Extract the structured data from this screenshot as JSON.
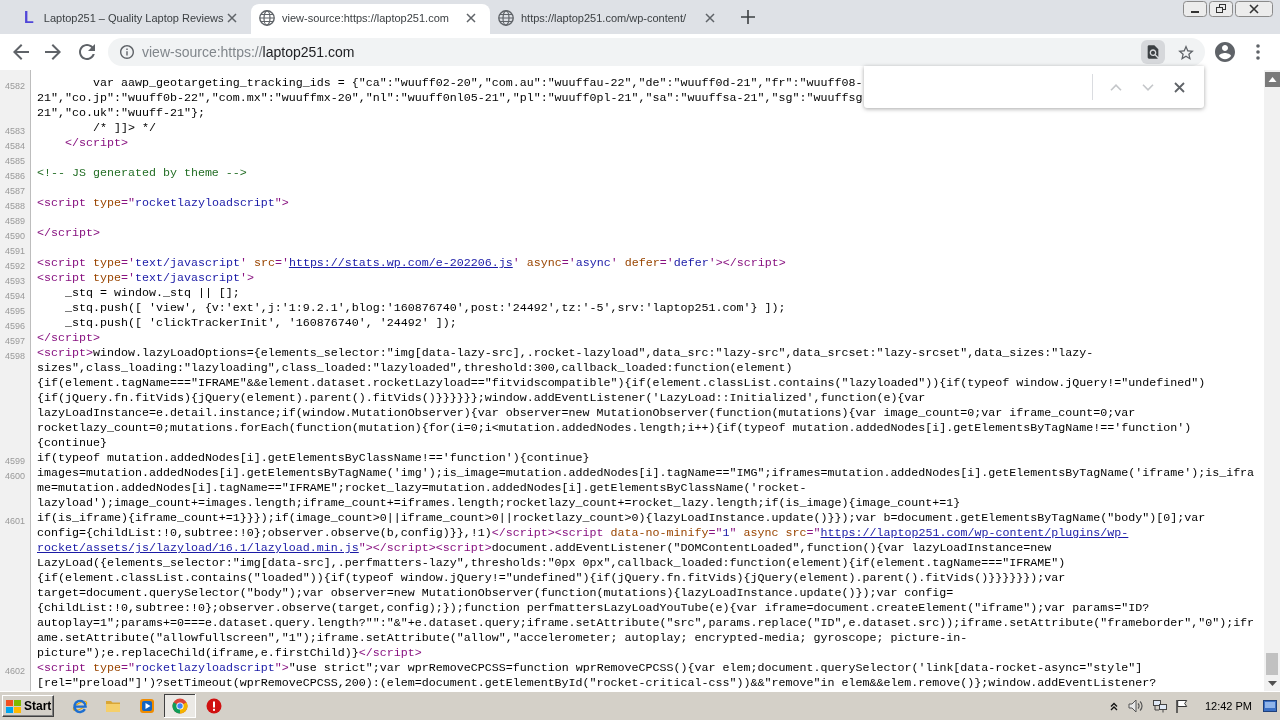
{
  "tabs": [
    {
      "title": "Laptop251 – Quality Laptop Reviews",
      "selected": false,
      "favicon": {
        "kind": "letter",
        "text": "L"
      }
    },
    {
      "title": "view-source:https://laptop251.com",
      "selected": true,
      "favicon": {
        "kind": "globe"
      }
    },
    {
      "title": "https://laptop251.com/wp-content/",
      "selected": false,
      "favicon": {
        "kind": "globe"
      }
    }
  ],
  "address_bar": {
    "url_prefix": "view-source:https://",
    "url_host": "laptop251.com",
    "find_active": true
  },
  "find_bar": {
    "previous_disabled": true,
    "next_disabled": true
  },
  "source_lines": [
    {
      "number": "4582",
      "rows": [
        {
          "tokens": [
            {
              "kind": "text",
              "text": "        var aawp_geotargeting_tracking_ids = {\"ca\":\"wuuff02-20\",\"com.au\":\"wuuffau-22\",\"de\":\"wuuff0d-21\",\"fr\":\"wuuff08-"
            }
          ]
        },
        {
          "tokens": [
            {
              "kind": "text",
              "text": "21\",\"co.jp\":\"wuuff0b-22\",\"com.mx\":\"wuuffmx-20\",\"nl\":\"wuuff0nl05-21\",\"pl\":\"wuuff0pl-21\",\"sa\":\"wuuffsa-21\",\"sg\":\"wuuffsg"
            }
          ]
        },
        {
          "tokens": [
            {
              "kind": "text",
              "text": "21\",\"co.uk\":\"wuuff-21\"};"
            }
          ]
        }
      ]
    },
    {
      "number": "4583",
      "rows": [
        {
          "tokens": [
            {
              "kind": "text",
              "text": "        /* ]]> */"
            }
          ]
        }
      ]
    },
    {
      "number": "4584",
      "rows": [
        {
          "tokens": [
            {
              "kind": "tag",
              "text": "    </script>"
            }
          ]
        }
      ]
    },
    {
      "number": "4585"
    },
    {
      "number": "4586",
      "rows": [
        {
          "tokens": [
            {
              "kind": "comment",
              "text": "<!-- JS generated by theme -->"
            }
          ]
        }
      ]
    },
    {
      "number": "4587"
    },
    {
      "number": "4588",
      "rows": [
        {
          "tokens": [
            {
              "kind": "tag",
              "text": "<script "
            },
            {
              "kind": "attr",
              "text": "type"
            },
            {
              "kind": "tag",
              "text": "=\""
            },
            {
              "kind": "value",
              "text": "rocketlazyloadscript"
            },
            {
              "kind": "tag",
              "text": "\">"
            }
          ]
        }
      ]
    },
    {
      "number": "4589"
    },
    {
      "number": "4590",
      "rows": [
        {
          "tokens": [
            {
              "kind": "tag",
              "text": "</script>"
            }
          ]
        }
      ]
    },
    {
      "number": "4591"
    },
    {
      "number": "4592",
      "rows": [
        {
          "tokens": [
            {
              "kind": "tag",
              "text": "<script "
            },
            {
              "kind": "attr",
              "text": "type"
            },
            {
              "kind": "tag",
              "text": "='"
            },
            {
              "kind": "value",
              "text": "text/javascript"
            },
            {
              "kind": "tag",
              "text": "' "
            },
            {
              "kind": "attr",
              "text": "src"
            },
            {
              "kind": "tag",
              "text": "='"
            },
            {
              "kind": "link",
              "text": "https://stats.wp.com/e-202206.js"
            },
            {
              "kind": "tag",
              "text": "' "
            },
            {
              "kind": "attr",
              "text": "async"
            },
            {
              "kind": "tag",
              "text": "='"
            },
            {
              "kind": "value",
              "text": "async"
            },
            {
              "kind": "tag",
              "text": "' "
            },
            {
              "kind": "attr",
              "text": "defer"
            },
            {
              "kind": "tag",
              "text": "='"
            },
            {
              "kind": "value",
              "text": "defer"
            },
            {
              "kind": "tag",
              "text": "'>"
            },
            {
              "kind": "tag",
              "text": "</script>"
            }
          ]
        }
      ]
    },
    {
      "number": "4593",
      "rows": [
        {
          "tokens": [
            {
              "kind": "tag",
              "text": "<script "
            },
            {
              "kind": "attr",
              "text": "type"
            },
            {
              "kind": "tag",
              "text": "='"
            },
            {
              "kind": "value",
              "text": "text/javascript"
            },
            {
              "kind": "tag",
              "text": "'>"
            }
          ]
        }
      ]
    },
    {
      "number": "4594",
      "rows": [
        {
          "tokens": [
            {
              "kind": "text",
              "text": "    _stq = window._stq || [];"
            }
          ]
        }
      ]
    },
    {
      "number": "4595",
      "rows": [
        {
          "tokens": [
            {
              "kind": "text",
              "text": "    _stq.push([ 'view', {v:'ext',j:'1:9.2.1',blog:'160876740',post:'24492',tz:'-5',srv:'laptop251.com'} ]);"
            }
          ]
        }
      ]
    },
    {
      "number": "4596",
      "rows": [
        {
          "tokens": [
            {
              "kind": "text",
              "text": "    _stq.push([ 'clickTrackerInit', '160876740', '24492' ]);"
            }
          ]
        }
      ]
    },
    {
      "number": "4597",
      "rows": [
        {
          "tokens": [
            {
              "kind": "tag",
              "text": "</script>"
            }
          ]
        }
      ]
    },
    {
      "number": "4598",
      "rows": [
        {
          "tokens": [
            {
              "kind": "tag",
              "text": "<script>"
            },
            {
              "kind": "text",
              "text": "window.lazyLoadOptions={elements_selector:\"img[data-lazy-src],.rocket-lazyload\",data_src:\"lazy-src\",data_srcset:\"lazy-srcset\",data_sizes:\"lazy-"
            }
          ]
        },
        {
          "tokens": [
            {
              "kind": "text",
              "text": "sizes\",class_loading:\"lazyloading\",class_loaded:\"lazyloaded\",threshold:300,callback_loaded:function(element)"
            }
          ]
        },
        {
          "tokens": [
            {
              "kind": "text",
              "text": "{if(element.tagName===\"IFRAME\"&&element.dataset.rocketLazyload==\"fitvidscompatible\"){if(element.classList.contains(\"lazyloaded\")){if(typeof window.jQuery!=\"undefined\")"
            }
          ]
        },
        {
          "tokens": [
            {
              "kind": "text",
              "text": "{if(jQuery.fn.fitVids){jQuery(element).parent().fitVids()}}}}}};window.addEventListener('LazyLoad::Initialized',function(e){var"
            }
          ]
        },
        {
          "tokens": [
            {
              "kind": "text",
              "text": "lazyLoadInstance=e.detail.instance;if(window.MutationObserver){var observer=new MutationObserver(function(mutations){var image_count=0;var iframe_count=0;var"
            }
          ]
        },
        {
          "tokens": [
            {
              "kind": "text",
              "text": "rocketlazy_count=0;mutations.forEach(function(mutation){for(i=0;i<mutation.addedNodes.length;i++){if(typeof mutation.addedNodes[i].getElementsByTagName!=='function')"
            }
          ]
        },
        {
          "tokens": [
            {
              "kind": "text",
              "text": "{continue}"
            }
          ]
        }
      ]
    },
    {
      "number": "4599",
      "rows": [
        {
          "tokens": [
            {
              "kind": "text",
              "text": "if(typeof mutation.addedNodes[i].getElementsByClassName!=='function'){continue}"
            }
          ]
        }
      ]
    },
    {
      "number": "4600",
      "rows": [
        {
          "tokens": [
            {
              "kind": "text",
              "text": "images=mutation.addedNodes[i].getElementsByTagName('img');is_image=mutation.addedNodes[i].tagName==\"IMG\";iframes=mutation.addedNodes[i].getElementsByTagName('iframe');is_ifra"
            }
          ]
        },
        {
          "tokens": [
            {
              "kind": "text",
              "text": "me=mutation.addedNodes[i].tagName==\"IFRAME\";rocket_lazy=mutation.addedNodes[i].getElementsByClassName('rocket-"
            }
          ]
        },
        {
          "tokens": [
            {
              "kind": "text",
              "text": "lazyload');image_count+=images.length;iframe_count+=iframes.length;rocketlazy_count+=rocket_lazy.length;if(is_image){image_count+=1}"
            }
          ]
        }
      ]
    },
    {
      "number": "4601",
      "rows": [
        {
          "tokens": [
            {
              "kind": "text",
              "text": "if(is_iframe){iframe_count+=1}}});if(image_count>0||iframe_count>0||rocketlazy_count>0){lazyLoadInstance.update()}});var b=document.getElementsByTagName(\"body\")[0];var"
            }
          ]
        },
        {
          "tokens": [
            {
              "kind": "text",
              "text": "config={childList:!0,subtree:!0};observer.observe(b,config)}},!1)"
            },
            {
              "kind": "tag",
              "text": "</script>"
            },
            {
              "kind": "tag",
              "text": "<script "
            },
            {
              "kind": "attr",
              "text": "data-no-minify"
            },
            {
              "kind": "tag",
              "text": "=\""
            },
            {
              "kind": "value",
              "text": "1"
            },
            {
              "kind": "tag",
              "text": "\" "
            },
            {
              "kind": "attr",
              "text": "async "
            },
            {
              "kind": "attr",
              "text": "src"
            },
            {
              "kind": "tag",
              "text": "=\""
            },
            {
              "kind": "link",
              "text": "https://laptop251.com/wp-content/plugins/wp-"
            }
          ]
        },
        {
          "tokens": [
            {
              "kind": "link",
              "text": "rocket/assets/js/lazyload/16.1/lazyload.min.js"
            },
            {
              "kind": "tag",
              "text": "\">"
            },
            {
              "kind": "tag",
              "text": "</script>"
            },
            {
              "kind": "tag",
              "text": "<script>"
            },
            {
              "kind": "text",
              "text": "document.addEventListener(\"DOMContentLoaded\",function(){var lazyLoadInstance=new"
            }
          ]
        },
        {
          "tokens": [
            {
              "kind": "text",
              "text": "LazyLoad({elements_selector:\"img[data-src],.perfmatters-lazy\",thresholds:\"0px 0px\",callback_loaded:function(element){if(element.tagName===\"IFRAME\")"
            }
          ]
        },
        {
          "tokens": [
            {
              "kind": "text",
              "text": "{if(element.classList.contains(\"loaded\")){if(typeof window.jQuery!=\"undefined\"){if(jQuery.fn.fitVids){jQuery(element).parent().fitVids()}}}}}});var"
            }
          ]
        },
        {
          "tokens": [
            {
              "kind": "text",
              "text": "target=document.querySelector(\"body\");var observer=new MutationObserver(function(mutations){lazyLoadInstance.update()});var config="
            }
          ]
        },
        {
          "tokens": [
            {
              "kind": "text",
              "text": "{childList:!0,subtree:!0};observer.observe(target,config);});function perfmattersLazyLoadYouTube(e){var iframe=document.createElement(\"iframe\");var params=\"ID?"
            }
          ]
        },
        {
          "tokens": [
            {
              "kind": "text",
              "text": "autoplay=1\";params+=0===e.dataset.query.length?\"\":\"&\"+e.dataset.query;iframe.setAttribute(\"src\",params.replace(\"ID\",e.dataset.src));iframe.setAttribute(\"frameborder\",\"0\");ifr"
            }
          ]
        },
        {
          "tokens": [
            {
              "kind": "text",
              "text": "ame.setAttribute(\"allowfullscreen\",\"1\");iframe.setAttribute(\"allow\",\"accelerometer; autoplay; encrypted-media; gyroscope; picture-in-"
            }
          ]
        },
        {
          "tokens": [
            {
              "kind": "text",
              "text": "picture\");e.replaceChild(iframe,e.firstChild)}"
            },
            {
              "kind": "tag",
              "text": "</script>"
            }
          ]
        }
      ]
    },
    {
      "number": "4602",
      "rows": [
        {
          "tokens": [
            {
              "kind": "tag",
              "text": "<script "
            },
            {
              "kind": "attr",
              "text": "type"
            },
            {
              "kind": "tag",
              "text": "=\""
            },
            {
              "kind": "value",
              "text": "rocketlazyloadscript"
            },
            {
              "kind": "tag",
              "text": "\">"
            },
            {
              "kind": "text",
              "text": "\"use strict\";var wprRemoveCPCSS=function wprRemoveCPCSS(){var elem;document.querySelector('link[data-rocket-async=\"style\"]"
            }
          ]
        },
        {
          "tokens": [
            {
              "kind": "text",
              "text": "[rel=\"preload\"]')?setTimeout(wprRemoveCPCSS,200):(elem=document.getElementById(\"rocket-critical-css\"))&&\"remove\"in elem&&elem.remove()};window.addEventListener?"
            }
          ]
        }
      ]
    }
  ],
  "taskbar": {
    "start_label": "Start",
    "items": [
      {
        "kind": "e-logo",
        "selected": false
      },
      {
        "kind": "folder",
        "selected": false
      },
      {
        "kind": "media",
        "selected": false
      },
      {
        "kind": "browser",
        "selected": true
      },
      {
        "kind": "alert",
        "selected": false
      }
    ],
    "clock": "12:42 PM"
  }
}
